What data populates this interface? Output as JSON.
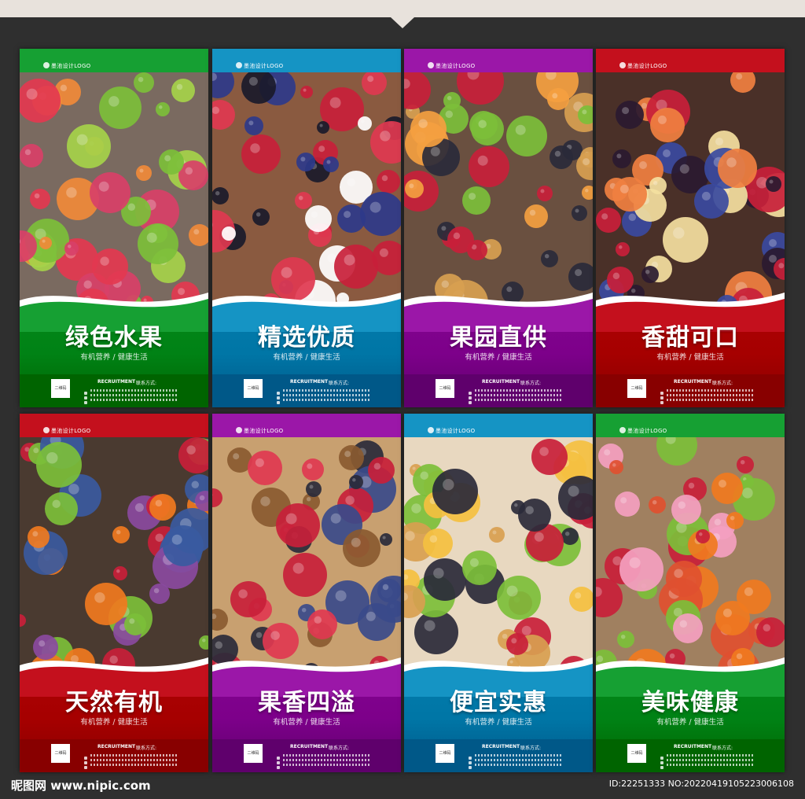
{
  "logo_text": "墨池设计LOGO",
  "subtitle": "有机营养 / 健康生活",
  "recruit": "RECRUITMENT",
  "contact": "联系方式:",
  "qr": "二维码",
  "posters": [
    {
      "title": "绿色水果",
      "color": "#16a033"
    },
    {
      "title": "精选优质",
      "color": "#1594c4"
    },
    {
      "title": "果园直供",
      "color": "#9b17a8"
    },
    {
      "title": "香甜可口",
      "color": "#c4101d"
    },
    {
      "title": "天然有机",
      "color": "#c4101d"
    },
    {
      "title": "果香四溢",
      "color": "#9b17a8"
    },
    {
      "title": "便宜实惠",
      "color": "#1594c4"
    },
    {
      "title": "美味健康",
      "color": "#16a033"
    }
  ],
  "footer_left": "昵图网 www.nipic.com",
  "footer_right": "ID:22251333 NO:20220419105223006108"
}
